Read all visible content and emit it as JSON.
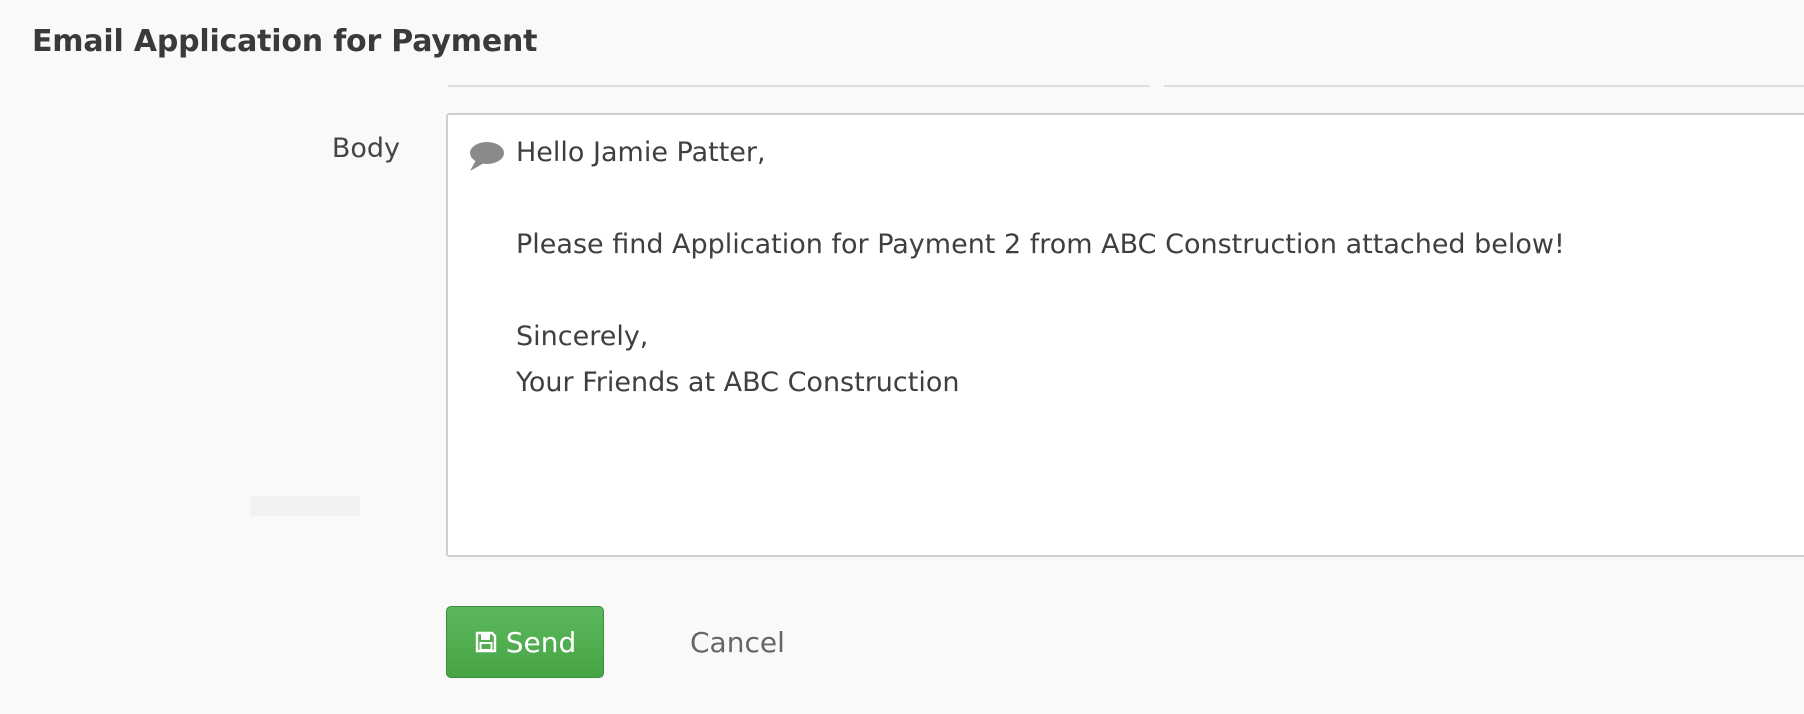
{
  "header": {
    "title": "Email Application for Payment"
  },
  "form": {
    "body_label": "Body",
    "body_lines": [
      "Hello Jamie Patter,",
      "",
      "Please find Application for Payment 2 from ABC Construction attached below!",
      "",
      "Sincerely,",
      "Your Friends at ABC Construction"
    ],
    "body_icon": "comment-icon"
  },
  "actions": {
    "send_label": "Send",
    "send_icon": "save-icon",
    "cancel_label": "Cancel"
  },
  "colors": {
    "send_button": "#4cae4c",
    "background": "#f9f9f9",
    "border": "#cfcfcf"
  }
}
